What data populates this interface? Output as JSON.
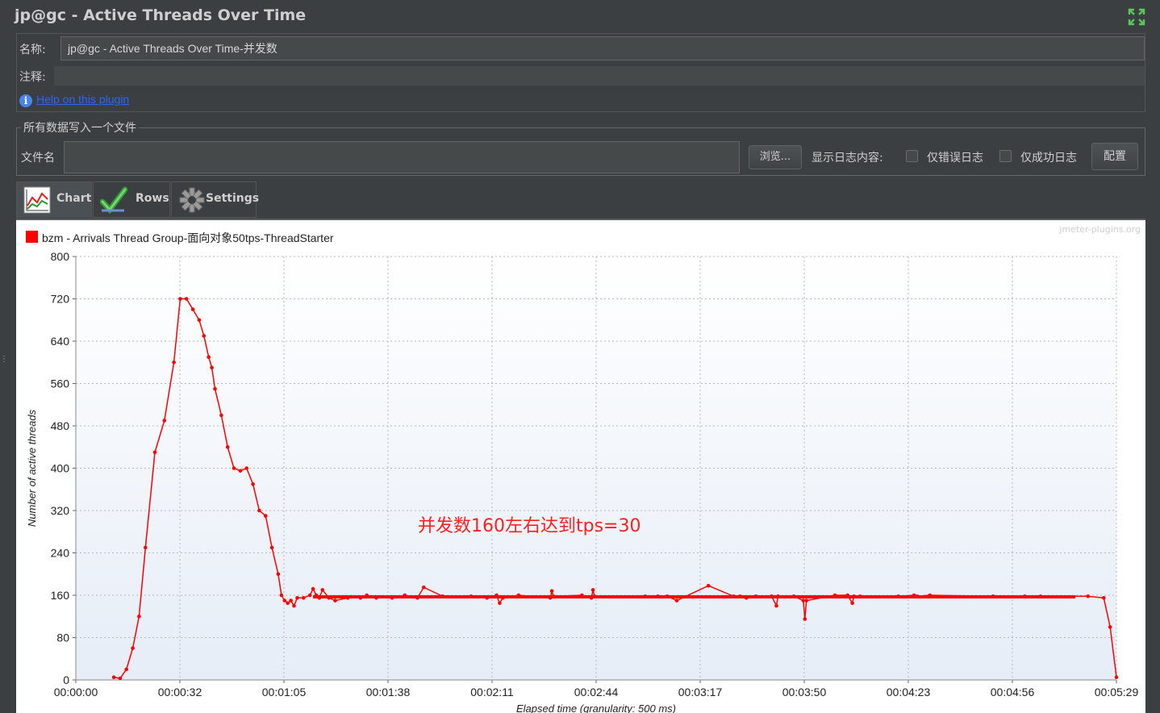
{
  "window": {
    "title": "jp@gc - Active Threads Over Time"
  },
  "info": {
    "name_label": "名称:",
    "name_value": "jp@gc - Active Threads Over Time-并发数",
    "comment_label": "注释:",
    "comment_value": "",
    "help_link": "Help on this plugin"
  },
  "file_panel": {
    "legend": "所有数据写入一个文件",
    "filename_label": "文件名",
    "filename_value": "",
    "browse_button": "浏览...",
    "log_label": "显示日志内容:",
    "errors_only_label": "仅错误日志",
    "errors_only_checked": false,
    "success_only_label": "仅成功日志",
    "success_only_checked": false,
    "configure_button": "配置"
  },
  "tabs": [
    {
      "label": "Chart",
      "icon": "chart-icon",
      "active": true
    },
    {
      "label": "Rows",
      "icon": "checkmark-icon",
      "active": false
    },
    {
      "label": "Settings",
      "icon": "gear-icon",
      "active": false
    }
  ],
  "chart_data": {
    "type": "line",
    "watermark": "jmeter-plugins.org",
    "ylabel": "Number of active threads",
    "xlabel": "Elapsed time (granularity: 500 ms)",
    "ylim": [
      0,
      800
    ],
    "yticks": [
      "0",
      "80",
      "160",
      "240",
      "320",
      "400",
      "480",
      "560",
      "640",
      "720",
      "800"
    ],
    "xlim_seconds": [
      0,
      329
    ],
    "xticks": [
      "00:00:00",
      "00:00:32",
      "00:01:05",
      "00:01:38",
      "00:02:11",
      "00:02:44",
      "00:03:17",
      "00:03:50",
      "00:04:23",
      "00:04:56",
      "00:05:29"
    ],
    "grid": true,
    "legend_position": "top-left",
    "annotation": "并发数160左右达到tps=30",
    "colors": {
      "series": "#ff0000",
      "annotation": "#ff2020"
    },
    "series": [
      {
        "name": "bzm - Arrivals Thread Group-面向对象50tps-ThreadStarter",
        "x_seconds": [
          12,
          14,
          16,
          18,
          20,
          22,
          25,
          28,
          31,
          33,
          35,
          37,
          39,
          40.5,
          42,
          43,
          44,
          46,
          48,
          50,
          52,
          54,
          56,
          58,
          60,
          62,
          64,
          65,
          66,
          67,
          68,
          69,
          70,
          72,
          74,
          75,
          76,
          77,
          78,
          80,
          82,
          86,
          90,
          92,
          95,
          100,
          104,
          108,
          110,
          116,
          125,
          130,
          133,
          134,
          135,
          140,
          150,
          150.5,
          151,
          160,
          163,
          163.5,
          164,
          180,
          184,
          187,
          190,
          200,
          208,
          210,
          212,
          215,
          220,
          221.5,
          222,
          227,
          230,
          230.5,
          231,
          240,
          244,
          245.5,
          246,
          248,
          260,
          265,
          266,
          270,
          290,
          300,
          305,
          320,
          325,
          327,
          329
        ],
        "values": [
          5,
          3,
          20,
          60,
          120,
          250,
          430,
          490,
          600,
          720,
          720,
          700,
          680,
          650,
          610,
          590,
          550,
          500,
          440,
          400,
          395,
          400,
          370,
          320,
          310,
          250,
          200,
          160,
          150,
          145,
          150,
          140,
          155,
          155,
          160,
          172,
          160,
          155,
          170,
          155,
          150,
          155,
          155,
          160,
          155,
          155,
          160,
          155,
          175,
          158,
          158,
          155,
          160,
          145,
          155,
          160,
          155,
          168,
          158,
          160,
          155,
          170,
          158,
          158,
          158,
          158,
          150,
          178,
          158,
          158,
          155,
          158,
          158,
          140,
          158,
          158,
          150,
          115,
          150,
          160,
          160,
          145,
          158,
          158,
          158,
          160,
          158,
          160,
          158,
          158,
          158,
          158,
          155,
          100,
          5
        ]
      }
    ]
  }
}
